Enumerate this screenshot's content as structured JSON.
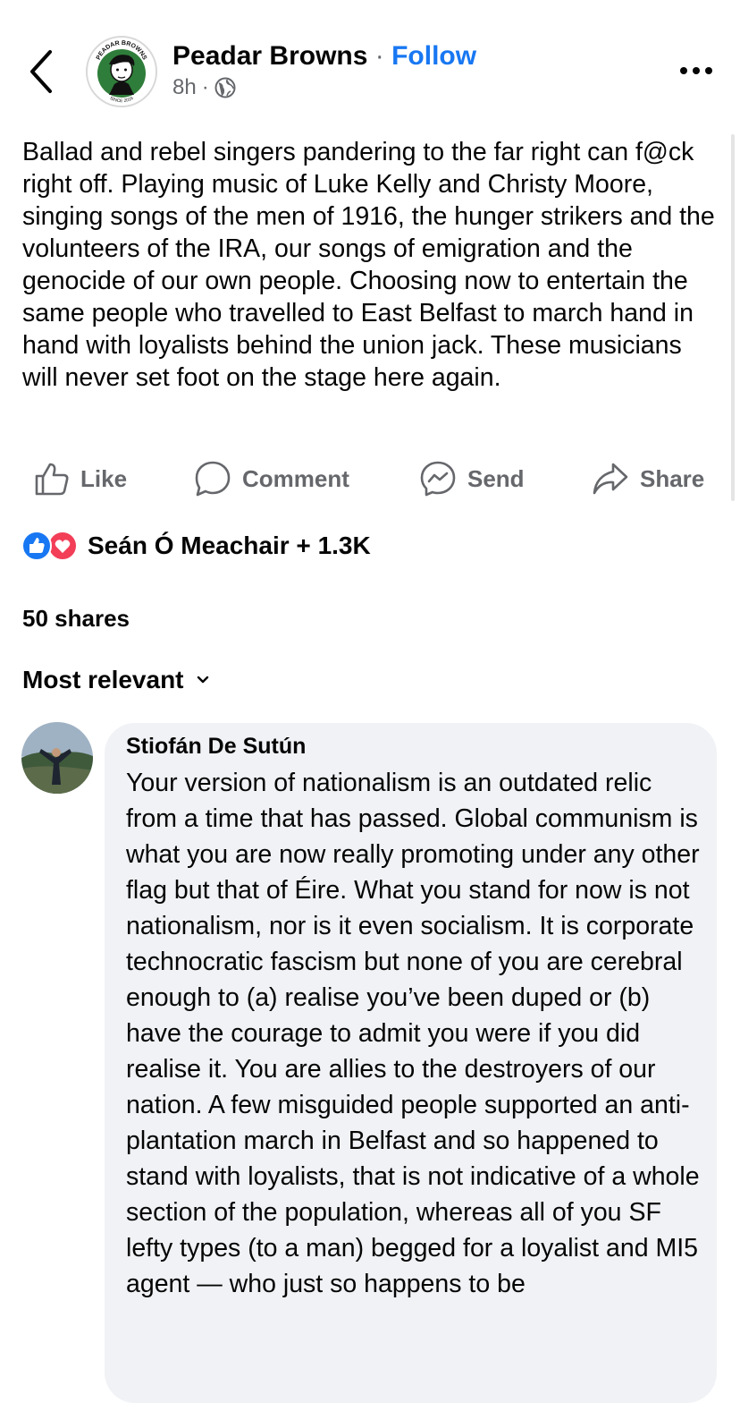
{
  "header": {
    "page_name": "Peadar Browns",
    "separator": "·",
    "follow_label": "Follow",
    "time": "8h",
    "meta_separator": "·",
    "audience_icon": "globe-icon",
    "logo_text_top": "PEADAR BROWNS",
    "logo_text_bottom": "SINCE 2016"
  },
  "post": {
    "text": "Ballad and rebel singers pandering to the far right can f@ck right off. Playing music of Luke Kelly and Christy Moore, singing songs of the men of 1916, the hunger strikers and the volunteers of the IRA, our songs of emigration and the genocide of our own people. Choosing now to entertain the same people who travelled to East Belfast to march hand in hand with loyalists behind the union jack. These musicians will never set foot on the stage here again."
  },
  "actions": {
    "like": "Like",
    "comment": "Comment",
    "send": "Send",
    "share": "Share"
  },
  "reactions": {
    "summary": "Seán Ó Meachair + 1.3K",
    "types": [
      "like-icon",
      "love-icon"
    ]
  },
  "shares": "50 shares",
  "sort": {
    "label": "Most relevant",
    "icon": "chevron-down-icon"
  },
  "comment": {
    "author": "Stiofán De Sutún",
    "text": "Your version of nationalism is an outdated relic from a time that has passed.  Global communism is what you are now really promoting under any other flag but that of Éire.  What you stand for now is not nationalism, nor is it even socialism.  It is corporate technocratic fascism but none of you are cerebral enough to (a) realise you’ve been duped or (b) have the courage to admit you were if you did realise it.  You are allies to the destroyers of our nation.  A few misguided people supported an anti-plantation march in Belfast and so happened to stand with loyalists, that is not indicative of a whole section of the population, whereas all of you SF lefty types (to a man) begged for a loyalist and MI5 agent — who just so happens to be"
  },
  "colors": {
    "accent": "#1877f2",
    "secondary_text": "#65676b",
    "bubble": "#f0f2f5",
    "love": "#f33e58"
  }
}
